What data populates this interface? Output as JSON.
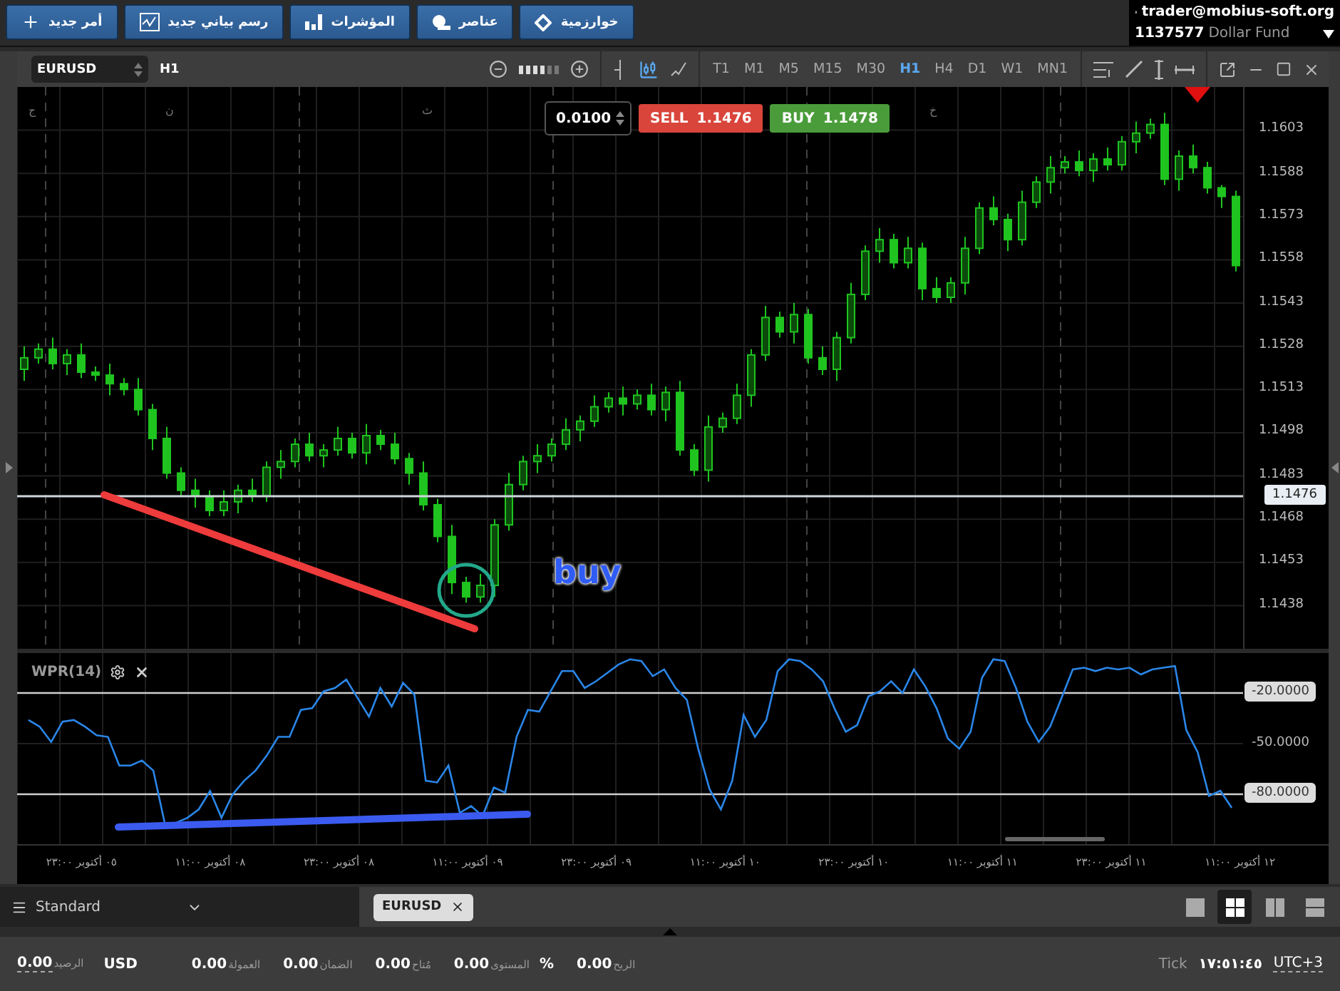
{
  "top_toolbar": {
    "buttons": [
      {
        "label": "خوارزمية"
      },
      {
        "label": "عناصر"
      },
      {
        "label": "المؤشرات"
      },
      {
        "label": "رسم بياني جديد"
      },
      {
        "label": "أمر جديد"
      }
    ]
  },
  "account": {
    "user": "trader@mobius-soft.org",
    "number": "1137577",
    "name": "Dollar Fund"
  },
  "chart_window": {
    "symbol": "EURUSD",
    "period": "H1",
    "timeframes": [
      {
        "label": "MN1",
        "selected": false
      },
      {
        "label": "W1",
        "selected": false
      },
      {
        "label": "D1",
        "selected": false
      },
      {
        "label": "H4",
        "selected": false
      },
      {
        "label": "H1",
        "selected": true
      },
      {
        "label": "M30",
        "selected": false
      },
      {
        "label": "M15",
        "selected": false
      },
      {
        "label": "M5",
        "selected": false
      },
      {
        "label": "M1",
        "selected": false
      },
      {
        "label": "T1",
        "selected": false
      }
    ],
    "order": {
      "lot": "0.0100",
      "sell": {
        "label": "SELL",
        "price": "1.1476"
      },
      "buy": {
        "label": "BUY",
        "price": "1.1478"
      }
    },
    "day_labels": [
      "خ",
      "ث",
      "ن",
      "ج"
    ],
    "chart_data": {
      "type": "candlestick",
      "grid": true,
      "ylim": [
        1.1423,
        1.1618
      ],
      "yticks": [
        {
          "value": 1.1603,
          "label": "1.1603"
        },
        {
          "value": 1.1588,
          "label": "1.1588"
        },
        {
          "value": 1.1573,
          "label": "1.1573"
        },
        {
          "value": 1.1558,
          "label": "1.1558"
        },
        {
          "value": 1.1543,
          "label": "1.1543"
        },
        {
          "value": 1.1528,
          "label": "1.1528"
        },
        {
          "value": 1.1513,
          "label": "1.1513"
        },
        {
          "value": 1.1498,
          "label": "1.1498"
        },
        {
          "value": 1.1483,
          "label": "1.1483"
        },
        {
          "value": 1.1468,
          "label": "1.1468"
        },
        {
          "value": 1.1453,
          "label": "1.1453"
        },
        {
          "value": 1.1438,
          "label": "1.1438"
        }
      ],
      "categories": [
        null,
        null,
        null,
        null,
        null,
        null,
        null,
        null,
        null,
        null,
        null,
        null,
        null,
        null,
        null,
        null,
        null,
        null,
        null,
        null,
        null,
        null,
        null,
        null,
        null,
        null,
        null,
        null,
        null,
        null,
        null,
        null,
        null,
        null,
        null,
        null,
        null,
        null,
        null,
        null,
        null,
        null,
        null,
        null,
        null,
        null,
        null,
        null,
        null,
        null,
        null,
        null,
        null,
        null,
        null,
        null,
        null,
        null,
        null,
        null,
        null,
        null,
        null,
        null,
        null,
        null,
        null,
        null,
        null,
        null,
        null,
        null,
        null,
        null,
        null,
        null,
        null,
        null,
        null,
        null,
        null,
        null,
        null,
        null,
        null,
        null
      ],
      "ohlc": [
        [
          1.152,
          1.1528,
          1.1516,
          1.1524
        ],
        [
          1.1524,
          1.1529,
          1.1522,
          1.1527
        ],
        [
          1.1527,
          1.1531,
          1.152,
          1.1522
        ],
        [
          1.1522,
          1.1527,
          1.1518,
          1.1525
        ],
        [
          1.1525,
          1.1529,
          1.1517,
          1.1519
        ],
        [
          1.1519,
          1.1521,
          1.1516,
          1.1518
        ],
        [
          1.1518,
          1.1522,
          1.1511,
          1.1515
        ],
        [
          1.1515,
          1.1517,
          1.1511,
          1.1513
        ],
        [
          1.1513,
          1.1517,
          1.1504,
          1.1506
        ],
        [
          1.1506,
          1.1508,
          1.1492,
          1.1496
        ],
        [
          1.1496,
          1.15,
          1.1482,
          1.1484
        ],
        [
          1.1484,
          1.1486,
          1.1476,
          1.1478
        ],
        [
          1.1478,
          1.1482,
          1.1472,
          1.1476
        ],
        [
          1.1476,
          1.1478,
          1.1469,
          1.1471
        ],
        [
          1.1471,
          1.1478,
          1.1469,
          1.1474
        ],
        [
          1.1474,
          1.148,
          1.147,
          1.1478
        ],
        [
          1.1478,
          1.1482,
          1.1474,
          1.1476
        ],
        [
          1.1476,
          1.1488,
          1.1474,
          1.1486
        ],
        [
          1.1486,
          1.1492,
          1.1482,
          1.1488
        ],
        [
          1.1488,
          1.1496,
          1.1486,
          1.1494
        ],
        [
          1.1494,
          1.1498,
          1.1488,
          1.149
        ],
        [
          1.149,
          1.1494,
          1.1486,
          1.1492
        ],
        [
          1.1492,
          1.15,
          1.149,
          1.1496
        ],
        [
          1.1496,
          1.1498,
          1.1489,
          1.1491
        ],
        [
          1.1491,
          1.1501,
          1.1487,
          1.1497
        ],
        [
          1.1497,
          1.1499,
          1.1492,
          1.1494
        ],
        [
          1.1494,
          1.1498,
          1.1487,
          1.1489
        ],
        [
          1.1489,
          1.1491,
          1.148,
          1.1484
        ],
        [
          1.1484,
          1.1488,
          1.1471,
          1.1473
        ],
        [
          1.1473,
          1.1475,
          1.146,
          1.1462
        ],
        [
          1.1462,
          1.1466,
          1.1442,
          1.1446
        ],
        [
          1.1446,
          1.1448,
          1.1439,
          1.1441
        ],
        [
          1.1441,
          1.1449,
          1.1439,
          1.1445
        ],
        [
          1.1445,
          1.1468,
          1.1441,
          1.1466
        ],
        [
          1.1466,
          1.1484,
          1.1464,
          1.148
        ],
        [
          1.148,
          1.149,
          1.1478,
          1.1488
        ],
        [
          1.1488,
          1.1494,
          1.1484,
          1.149
        ],
        [
          1.149,
          1.1496,
          1.1488,
          1.1494
        ],
        [
          1.1494,
          1.1503,
          1.1492,
          1.1499
        ],
        [
          1.1499,
          1.1504,
          1.1495,
          1.1502
        ],
        [
          1.1502,
          1.1511,
          1.15,
          1.1507
        ],
        [
          1.1507,
          1.1512,
          1.1505,
          1.151
        ],
        [
          1.151,
          1.1514,
          1.1504,
          1.1508
        ],
        [
          1.1508,
          1.1513,
          1.1506,
          1.1511
        ],
        [
          1.1511,
          1.1515,
          1.1504,
          1.1506
        ],
        [
          1.1506,
          1.1514,
          1.1502,
          1.1512
        ],
        [
          1.1512,
          1.1516,
          1.149,
          1.1492
        ],
        [
          1.1492,
          1.1494,
          1.1483,
          1.1485
        ],
        [
          1.1485,
          1.1504,
          1.1481,
          1.15
        ],
        [
          1.15,
          1.1505,
          1.1498,
          1.1503
        ],
        [
          1.1503,
          1.1515,
          1.1501,
          1.1511
        ],
        [
          1.1511,
          1.1527,
          1.1507,
          1.1525
        ],
        [
          1.1525,
          1.1542,
          1.1523,
          1.1538
        ],
        [
          1.1538,
          1.154,
          1.1531,
          1.1533
        ],
        [
          1.1533,
          1.1543,
          1.1529,
          1.1539
        ],
        [
          1.1539,
          1.1541,
          1.1522,
          1.1524
        ],
        [
          1.1524,
          1.1528,
          1.1518,
          1.152
        ],
        [
          1.152,
          1.1533,
          1.1516,
          1.1531
        ],
        [
          1.1531,
          1.155,
          1.1529,
          1.1546
        ],
        [
          1.1546,
          1.1563,
          1.1544,
          1.1561
        ],
        [
          1.1561,
          1.1569,
          1.1557,
          1.1565
        ],
        [
          1.1565,
          1.1567,
          1.1555,
          1.1557
        ],
        [
          1.1557,
          1.1566,
          1.1555,
          1.1562
        ],
        [
          1.1562,
          1.1564,
          1.1544,
          1.1548
        ],
        [
          1.1548,
          1.1552,
          1.1543,
          1.1545
        ],
        [
          1.1545,
          1.1552,
          1.1543,
          1.155
        ],
        [
          1.155,
          1.1566,
          1.1546,
          1.1562
        ],
        [
          1.1562,
          1.1578,
          1.156,
          1.1576
        ],
        [
          1.1576,
          1.158,
          1.157,
          1.1572
        ],
        [
          1.1572,
          1.1574,
          1.1561,
          1.1565
        ],
        [
          1.1565,
          1.1582,
          1.1563,
          1.1578
        ],
        [
          1.1578,
          1.1587,
          1.1576,
          1.1585
        ],
        [
          1.1585,
          1.1594,
          1.1581,
          1.159
        ],
        [
          1.159,
          1.1594,
          1.1588,
          1.1592
        ],
        [
          1.1592,
          1.1596,
          1.1587,
          1.1589
        ],
        [
          1.1589,
          1.1595,
          1.1585,
          1.1593
        ],
        [
          1.1593,
          1.1597,
          1.1589,
          1.1591
        ],
        [
          1.1591,
          1.1601,
          1.1589,
          1.1599
        ],
        [
          1.1599,
          1.1606,
          1.1595,
          1.1602
        ],
        [
          1.1602,
          1.1607,
          1.16,
          1.1605
        ],
        [
          1.1605,
          1.1609,
          1.1584,
          1.1586
        ],
        [
          1.1586,
          1.1596,
          1.1582,
          1.1594
        ],
        [
          1.1594,
          1.1598,
          1.1588,
          1.159
        ],
        [
          1.159,
          1.1592,
          1.1581,
          1.1583
        ],
        [
          1.1583,
          1.1584,
          1.1576,
          1.158
        ],
        [
          1.158,
          1.1582,
          1.1554,
          1.1556
        ]
      ]
    },
    "current_price": "1.1476",
    "annotation": "buy",
    "indicator": {
      "chart_data": {
        "type": "line",
        "grid": true,
        "ylim": [
          -109.6,
          3.7
        ],
        "yticks": [
          {
            "value": -20,
            "label": "-20.0000"
          },
          {
            "value": -50,
            "label": "-50.0000"
          },
          {
            "value": -80,
            "label": "-80.0000"
          }
        ],
        "series": [
          {
            "name": "WPR(14)",
            "color": "#2a86e8",
            "values": [
              -36,
              -40,
              -49,
              -37,
              -36,
              -40,
              -45,
              -46,
              -63,
              -63,
              -60,
              -66,
              -97,
              -97,
              -94,
              -89,
              -78,
              -94,
              -80,
              -72,
              -66,
              -57,
              -46,
              -46,
              -30,
              -29,
              -19,
              -17,
              -12,
              -23,
              -34,
              -17,
              -28,
              -14,
              -21,
              -72,
              -73,
              -63,
              -91,
              -87,
              -93,
              -76,
              -79,
              -46,
              -30,
              -31,
              -19,
              -7,
              -7,
              -17,
              -13,
              -8,
              -3,
              0,
              -1,
              -10,
              -6,
              -17,
              -24,
              -53,
              -77,
              -89,
              -72,
              -33,
              -46,
              -36,
              -7,
              0,
              -1,
              -6,
              -13,
              -29,
              -43,
              -39,
              -22,
              -19,
              -13,
              -20,
              -6,
              -16,
              -29,
              -47,
              -53,
              -43,
              -11,
              0,
              -1,
              -17,
              -37,
              -49,
              -40,
              -23,
              -6,
              -5,
              -7,
              -5,
              -6,
              -5,
              -9,
              -6,
              -5,
              -4,
              -42,
              -55,
              -81,
              -78,
              -88
            ]
          }
        ]
      }
    },
    "time_axis": [
      "١٢ أكتوبر ١١:٠٠",
      "١١ أكتوبر ٢٣:٠٠",
      "١١ أكتوبر ١١:٠٠",
      "١٠ أكتوبر ٢٣:٠٠",
      "١٠ أكتوبر ١١:٠٠",
      "٠٩ أكتوبر ٢٣:٠٠",
      "٠٩ أكتوبر ١١:٠٠",
      "٠٨ أكتوبر ٢٣:٠٠",
      "٠٨ أكتوبر ١١:٠٠",
      "٠٥ أكتوبر ٢٣:٠٠"
    ]
  },
  "workspace": {
    "name": "Standard",
    "tabs": [
      {
        "label": "EURUSD",
        "selected": true
      }
    ],
    "layouts": [
      {
        "selected": false
      },
      {
        "selected": true
      },
      {
        "selected": false
      },
      {
        "selected": false
      }
    ]
  },
  "status_bar": {
    "balance": {
      "label": "الرصيد",
      "value": "0.00"
    },
    "currency": "USD",
    "items": [
      {
        "label": "الربح",
        "value": "0.00"
      },
      {
        "label": "المستوى",
        "value": "0.00",
        "unit": "%"
      },
      {
        "label": "مُتاح",
        "value": "0.00"
      },
      {
        "label": "الضمان",
        "value": "0.00"
      },
      {
        "label": "العمولة",
        "value": "0.00"
      }
    ],
    "tick_label": "Tick",
    "time": "١٧:٥١:٤٥",
    "timezone": "UTC+3"
  }
}
